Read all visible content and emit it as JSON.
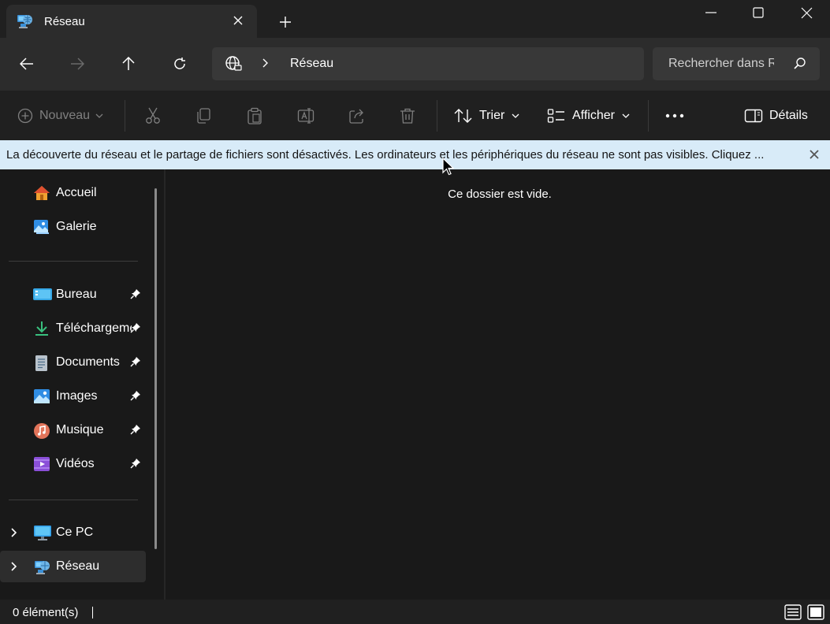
{
  "tab": {
    "title": "Réseau"
  },
  "address": {
    "crumb": "Réseau"
  },
  "search": {
    "placeholder": "Rechercher dans Réseau"
  },
  "toolbar": {
    "new_label": "Nouveau",
    "sort_label": "Trier",
    "view_label": "Afficher",
    "details_label": "Détails"
  },
  "infobar": {
    "message": "La découverte du réseau et le partage de fichiers sont désactivés. Les ordinateurs et les périphériques du réseau ne sont pas visibles. Cliquez ..."
  },
  "sidebar": {
    "items": [
      {
        "label": "Accueil",
        "icon": "home-icon"
      },
      {
        "label": "Galerie",
        "icon": "gallery-icon"
      },
      {
        "label": "Bureau",
        "icon": "desktop-folder-icon",
        "pinned": true
      },
      {
        "label": "Téléchargements",
        "icon": "download-icon",
        "pinned": true
      },
      {
        "label": "Documents",
        "icon": "documents-icon",
        "pinned": true
      },
      {
        "label": "Images",
        "icon": "images-icon",
        "pinned": true
      },
      {
        "label": "Musique",
        "icon": "music-icon",
        "pinned": true
      },
      {
        "label": "Vidéos",
        "icon": "videos-icon",
        "pinned": true
      },
      {
        "label": "Ce PC",
        "icon": "pc-icon",
        "expandable": true
      },
      {
        "label": "Réseau",
        "icon": "network-icon",
        "expandable": true,
        "selected": true
      }
    ]
  },
  "content": {
    "empty_message": "Ce dossier est vide."
  },
  "status": {
    "count": "0 élément(s)"
  },
  "colors": {
    "background": "#191919",
    "chrome": "#202020",
    "address_row": "#2c2c2c",
    "infobar": "#d8ebf8",
    "accent_blue": "#4cc2ff"
  }
}
